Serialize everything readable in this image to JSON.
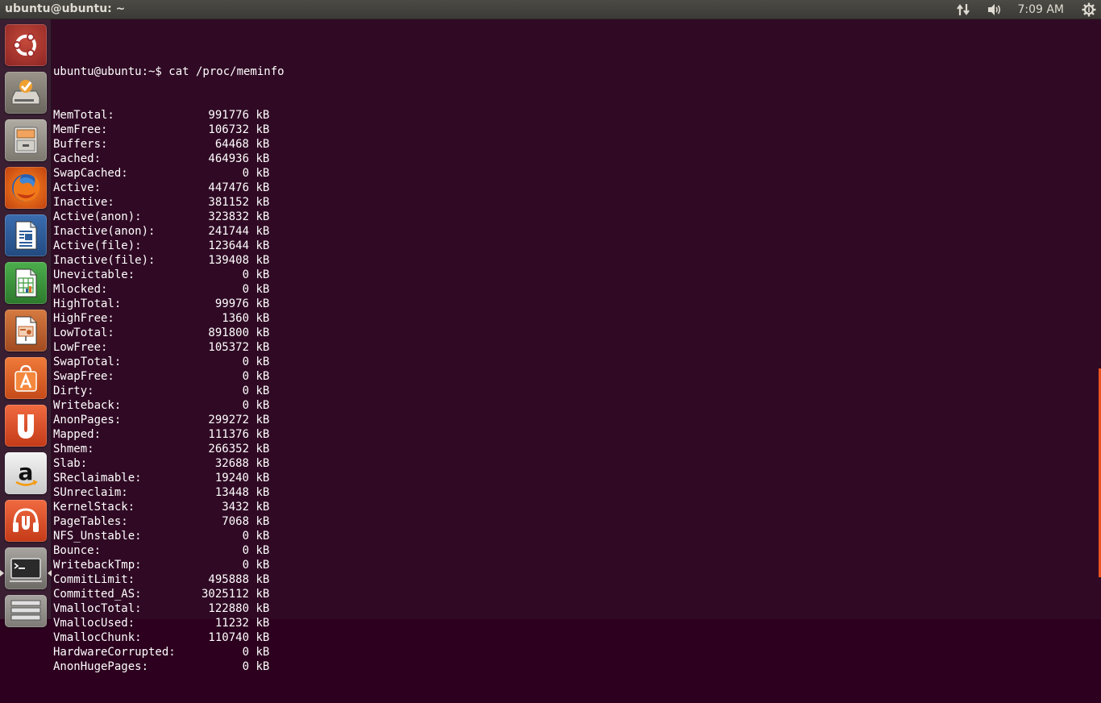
{
  "panel": {
    "window_title": "ubuntu@ubuntu: ~",
    "clock": "7:09 AM",
    "icons": [
      "network-arrows-icon",
      "volume-icon",
      "gear-icon"
    ]
  },
  "launcher": {
    "items": [
      {
        "name": "ubuntu-dash",
        "icon": "ubuntu-logo-icon",
        "color": "#a22e2e"
      },
      {
        "name": "ubuntu-installer",
        "icon": "installer-drive-icon",
        "color": "#8a8478"
      },
      {
        "name": "files",
        "icon": "file-cabinet-icon",
        "color": "#9a968e"
      },
      {
        "name": "firefox",
        "icon": "firefox-icon",
        "color": "#e66000"
      },
      {
        "name": "libreoffice-writer",
        "icon": "writer-document-icon",
        "color": "#2c5d9a"
      },
      {
        "name": "libreoffice-calc",
        "icon": "calc-spreadsheet-icon",
        "color": "#3c9b3c"
      },
      {
        "name": "libreoffice-impress",
        "icon": "impress-presentation-icon",
        "color": "#c0602a"
      },
      {
        "name": "ubuntu-software",
        "icon": "shopping-bag-icon",
        "color": "#e86b2f"
      },
      {
        "name": "ubuntu-one",
        "icon": "ubuntu-one-icon",
        "color": "#e8512b"
      },
      {
        "name": "amazon",
        "icon": "amazon-icon",
        "color": "#dedede"
      },
      {
        "name": "ubuntu-one-music",
        "icon": "headphones-icon",
        "color": "#e8512b"
      },
      {
        "name": "terminal",
        "icon": "terminal-icon",
        "color": "#8d8a85"
      },
      {
        "name": "workspace",
        "icon": "stacked-icon",
        "color": "#8d8a85"
      }
    ]
  },
  "terminal": {
    "prompt": "ubuntu@ubuntu:~$ cat /proc/meminfo",
    "lines": [
      {
        "label": "MemTotal:",
        "value": "991776",
        "unit": "kB"
      },
      {
        "label": "MemFree:",
        "value": "106732",
        "unit": "kB"
      },
      {
        "label": "Buffers:",
        "value": "64468",
        "unit": "kB"
      },
      {
        "label": "Cached:",
        "value": "464936",
        "unit": "kB"
      },
      {
        "label": "SwapCached:",
        "value": "0",
        "unit": "kB"
      },
      {
        "label": "Active:",
        "value": "447476",
        "unit": "kB"
      },
      {
        "label": "Inactive:",
        "value": "381152",
        "unit": "kB"
      },
      {
        "label": "Active(anon):",
        "value": "323832",
        "unit": "kB"
      },
      {
        "label": "Inactive(anon):",
        "value": "241744",
        "unit": "kB"
      },
      {
        "label": "Active(file):",
        "value": "123644",
        "unit": "kB"
      },
      {
        "label": "Inactive(file):",
        "value": "139408",
        "unit": "kB"
      },
      {
        "label": "Unevictable:",
        "value": "0",
        "unit": "kB"
      },
      {
        "label": "Mlocked:",
        "value": "0",
        "unit": "kB"
      },
      {
        "label": "HighTotal:",
        "value": "99976",
        "unit": "kB"
      },
      {
        "label": "HighFree:",
        "value": "1360",
        "unit": "kB"
      },
      {
        "label": "LowTotal:",
        "value": "891800",
        "unit": "kB"
      },
      {
        "label": "LowFree:",
        "value": "105372",
        "unit": "kB"
      },
      {
        "label": "SwapTotal:",
        "value": "0",
        "unit": "kB"
      },
      {
        "label": "SwapFree:",
        "value": "0",
        "unit": "kB"
      },
      {
        "label": "Dirty:",
        "value": "0",
        "unit": "kB"
      },
      {
        "label": "Writeback:",
        "value": "0",
        "unit": "kB"
      },
      {
        "label": "AnonPages:",
        "value": "299272",
        "unit": "kB"
      },
      {
        "label": "Mapped:",
        "value": "111376",
        "unit": "kB"
      },
      {
        "label": "Shmem:",
        "value": "266352",
        "unit": "kB"
      },
      {
        "label": "Slab:",
        "value": "32688",
        "unit": "kB"
      },
      {
        "label": "SReclaimable:",
        "value": "19240",
        "unit": "kB"
      },
      {
        "label": "SUnreclaim:",
        "value": "13448",
        "unit": "kB"
      },
      {
        "label": "KernelStack:",
        "value": "3432",
        "unit": "kB"
      },
      {
        "label": "PageTables:",
        "value": "7068",
        "unit": "kB"
      },
      {
        "label": "NFS_Unstable:",
        "value": "0",
        "unit": "kB"
      },
      {
        "label": "Bounce:",
        "value": "0",
        "unit": "kB"
      },
      {
        "label": "WritebackTmp:",
        "value": "0",
        "unit": "kB"
      },
      {
        "label": "CommitLimit:",
        "value": "495888",
        "unit": "kB"
      },
      {
        "label": "Committed_AS:",
        "value": "3025112",
        "unit": "kB"
      },
      {
        "label": "VmallocTotal:",
        "value": "122880",
        "unit": "kB"
      },
      {
        "label": "VmallocUsed:",
        "value": "11232",
        "unit": "kB"
      },
      {
        "label": "VmallocChunk:",
        "value": "110740",
        "unit": "kB"
      },
      {
        "label": "HardwareCorrupted:",
        "value": "0",
        "unit": "kB"
      },
      {
        "label": "AnonHugePages:",
        "value": "0",
        "unit": "kB"
      }
    ]
  },
  "colors": {
    "terminal_bg": "#300a24",
    "panel_bg": "#3c3b37",
    "accent": "#e95420"
  }
}
